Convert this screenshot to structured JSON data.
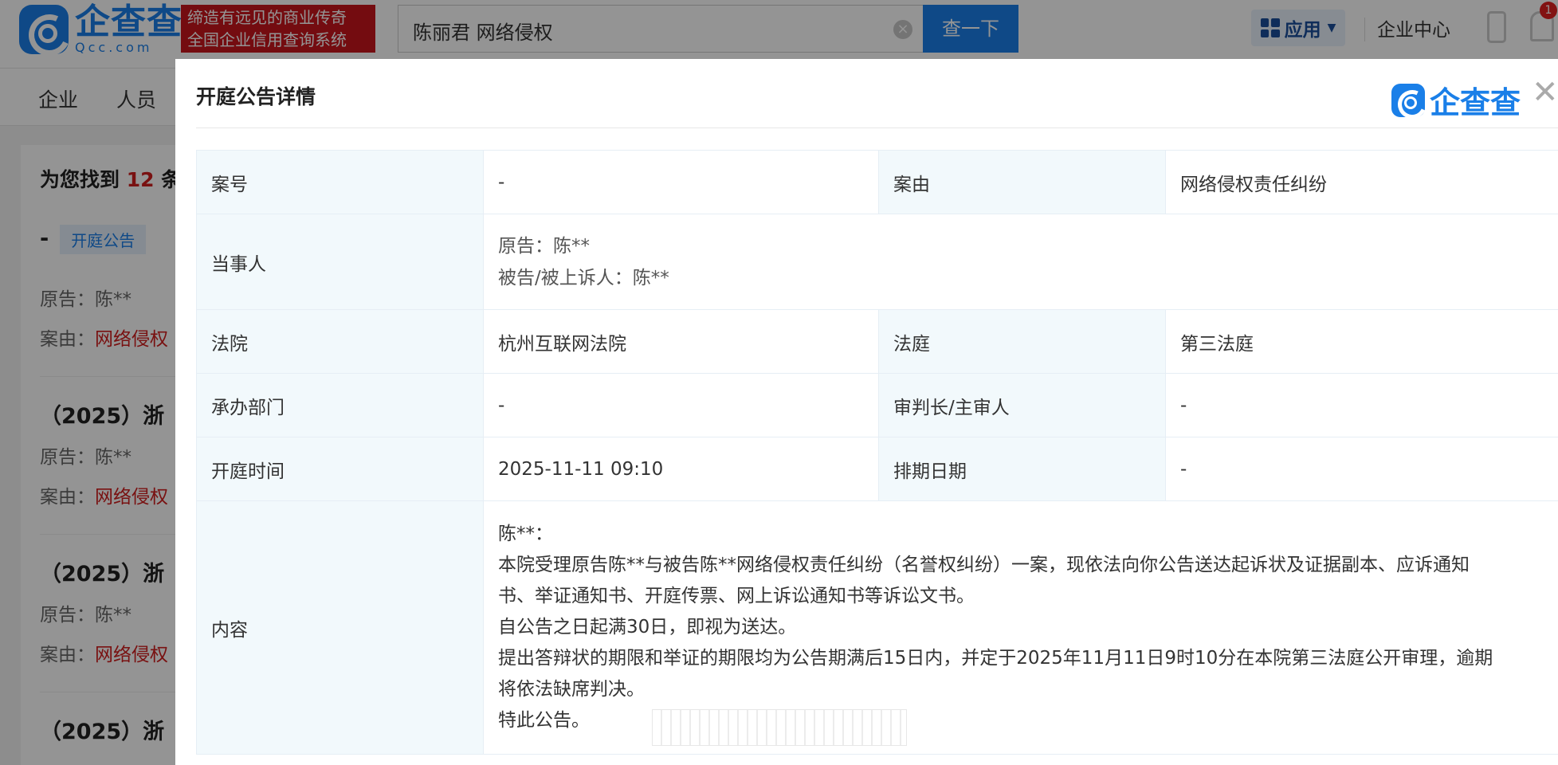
{
  "header": {
    "logo_cn": "企查查",
    "logo_en": "Qcc.com",
    "slogan_line1": "缔造有远见的商业传奇",
    "slogan_line2": "全国企业信用查询系统",
    "search_value": "陈丽君 网络侵权",
    "search_button": "查一下",
    "app_button": "应用",
    "enterprise_center": "企业中心",
    "badge_count": "1"
  },
  "nav": {
    "items": [
      "企业",
      "人员"
    ]
  },
  "results": {
    "found_prefix": "为您找到",
    "found_count": "12",
    "found_suffix": "条",
    "first_title": "-",
    "first_tag": "开庭公告",
    "plaintiff_label": "原告：陈**",
    "cause_label": "案由：",
    "cause_value": "网络侵权",
    "case_prefix": "（2025）浙"
  },
  "modal": {
    "title": "开庭公告详情",
    "brand": "企查查",
    "rows": {
      "case_no_label": "案号",
      "case_no_value": "-",
      "cause_label": "案由",
      "cause_value": "网络侵权责任纠纷",
      "parties_label": "当事人",
      "plaintiff": "原告：陈**",
      "defendant": "被告/被上诉人：陈**",
      "court_label": "法院",
      "court_value": "杭州互联网法院",
      "courtroom_label": "法庭",
      "courtroom_value": "第三法庭",
      "dept_label": "承办部门",
      "dept_value": "-",
      "judge_label": "审判长/主审人",
      "judge_value": "-",
      "time_label": "开庭时间",
      "time_value": "2025-11-11 09:10",
      "schedule_label": "排期日期",
      "schedule_value": "-",
      "content_label": "内容",
      "content_lines": [
        "陈**：",
        "本院受理原告陈**与被告陈**网络侵权责任纠纷（名誉权纠纷）一案，现依法向你公告送达起诉状及证据副本、应诉通知",
        "书、举证通知书、开庭传票、网上诉讼通知书等诉讼文书。",
        "自公告之日起满30日，即视为送达。",
        "提出答辩状的期限和举证的期限均为公告期满后15日内，并定于2025年11月11日9时10分在本院第三法庭公开审理，逾期",
        "将依法缺席判决。",
        "特此公告。"
      ]
    }
  }
}
